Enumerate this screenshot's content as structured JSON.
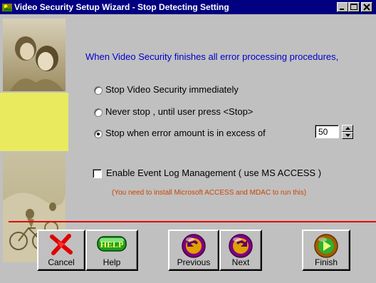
{
  "window": {
    "title": "Video Security Setup Wizard - Stop Detecting Setting",
    "controls": [
      "minimize",
      "maximize",
      "close"
    ]
  },
  "message": "When Video Security finishes all error processing procedures,",
  "options": [
    {
      "label": "Stop Video Security immediately",
      "selected": false
    },
    {
      "label": "Never stop , until user press <Stop>",
      "selected": false
    },
    {
      "label": "Stop when error amount is in excess of",
      "selected": true
    }
  ],
  "error_threshold": "50",
  "event_log": {
    "label": "Enable Event Log Management ( use MS ACCESS )",
    "checked": false,
    "note": "(You need to install Microsoft ACCESS and MDAC to run this)"
  },
  "buttons": {
    "cancel": "Cancel",
    "help": "Help",
    "help_icon_text": "HELP",
    "previous": "Previous",
    "next": "Next",
    "finish": "Finish"
  },
  "colors": {
    "title_bar": "#000080",
    "message_text": "#0000cc",
    "note_text": "#cc4400",
    "divider": "#e00000"
  }
}
